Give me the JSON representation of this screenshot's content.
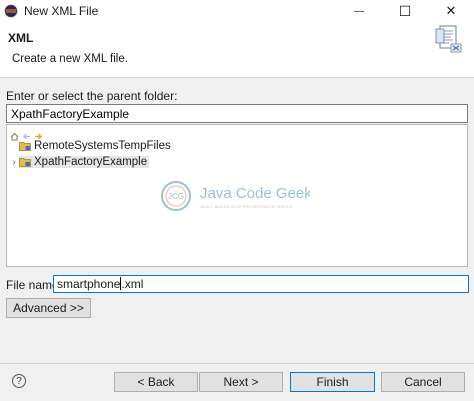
{
  "window": {
    "title": "New XML File",
    "minimize_glyph": "—",
    "maximize_glyph": "☐",
    "close_glyph": "✕"
  },
  "header": {
    "title": "XML",
    "description": "Create a new XML file."
  },
  "folder": {
    "label": "Enter or select the parent folder:",
    "value": "XpathFactoryExample"
  },
  "tree": {
    "items": [
      {
        "label": "RemoteSystemsTempFiles",
        "expandable": false,
        "selected": false
      },
      {
        "label": "XpathFactoryExample",
        "expandable": true,
        "selected": true
      }
    ],
    "expand_glyph": "›"
  },
  "watermark": {
    "logo_text": "JCG",
    "brand": "Java Code Geeks",
    "tagline": "JAVA 2 JAVA DEVELOPERS RESOURCE CENTER"
  },
  "filename": {
    "label": "File name:",
    "value_before_caret": "smartphone",
    "value_after_caret": ".xml"
  },
  "buttons": {
    "advanced": "Advanced >>",
    "back": "< Back",
    "next": "Next >",
    "finish": "Finish",
    "cancel": "Cancel",
    "help_glyph": "?"
  },
  "colors": {
    "accent": "#0078d7",
    "folder": "#e8b84a",
    "watermark_blue": "#2a6fb0",
    "watermark_orange": "#e07a1f"
  }
}
